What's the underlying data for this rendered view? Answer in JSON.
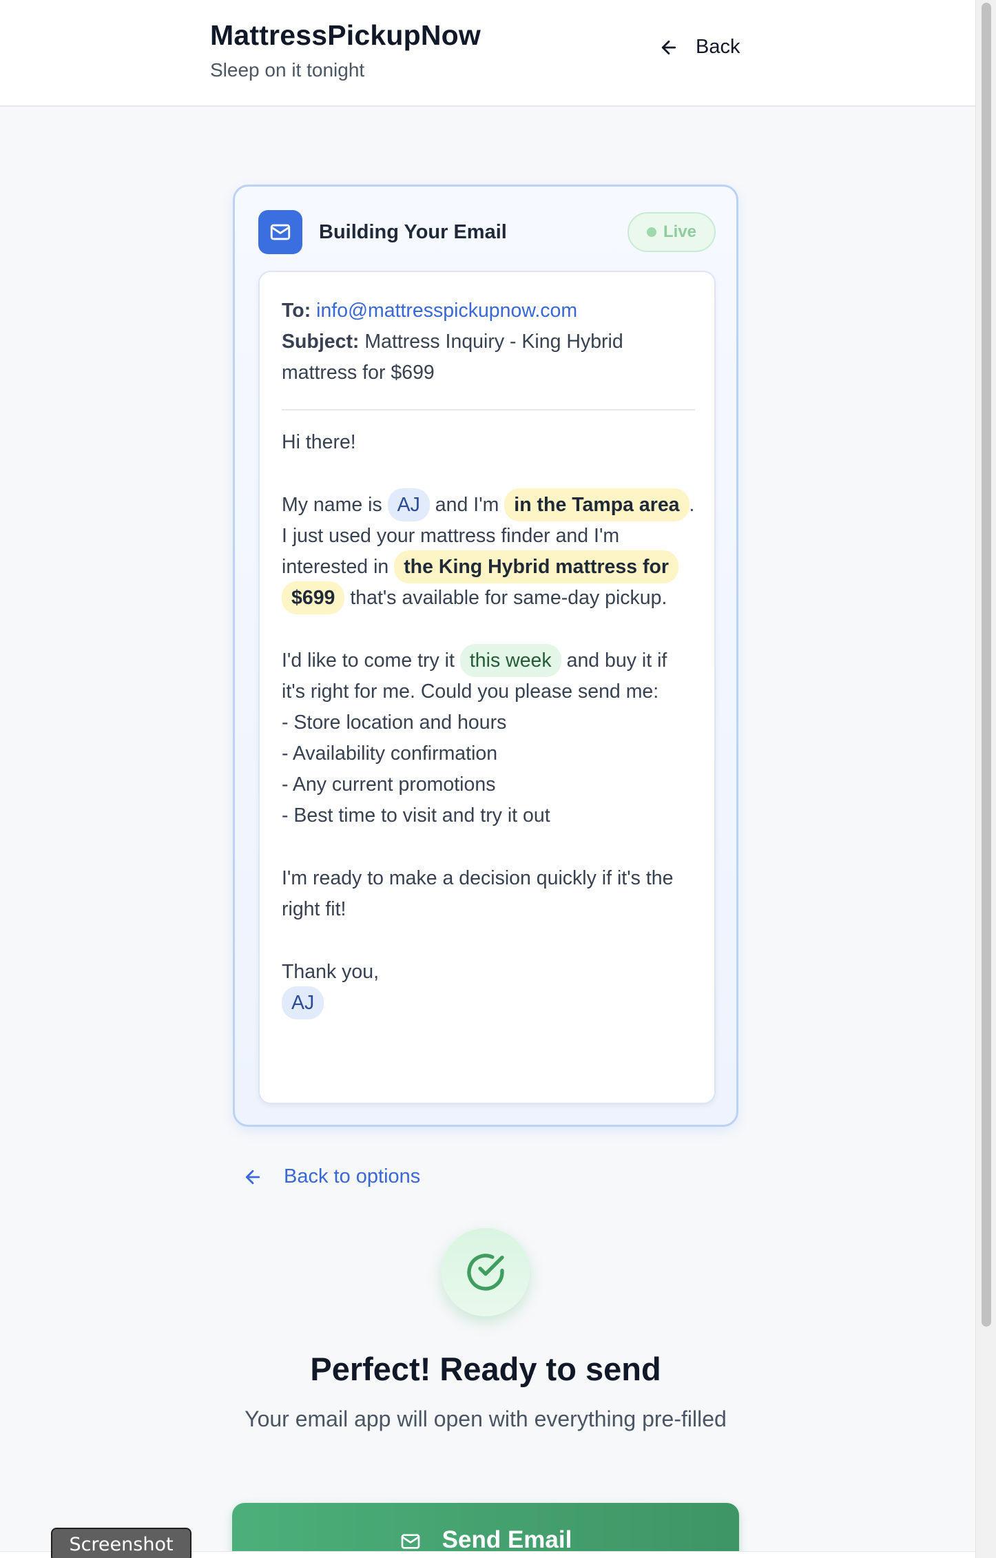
{
  "header": {
    "brand": "MattressPickupNow",
    "tagline": "Sleep on it tonight",
    "back_label": "Back"
  },
  "card": {
    "title": "Building Your Email",
    "status": "Live",
    "to_label": "To:",
    "to_value": "info@mattresspickupnow.com",
    "subject_label": "Subject:",
    "subject_value": "Mattress Inquiry - King Hybrid mattress for $699",
    "greeting": "Hi there!",
    "p1": {
      "a": "My name is ",
      "name": "AJ",
      "b": " and I'm ",
      "location": "in the Tampa area",
      "c": ". I just used your mattress finder and I'm interested in ",
      "product": "the King Hybrid mattress for $699",
      "d": " that's available for same-day pickup."
    },
    "p2": {
      "a": "I'd like to come try it ",
      "timeframe": "this week",
      "b": " and buy it if it's right for me. Could you please send me:"
    },
    "list": [
      "- Store location and hours",
      "- Availability confirmation",
      "- Any current promotions",
      "- Best time to visit and try it out"
    ],
    "p3": "I'm ready to make a decision quickly if it's the right fit!",
    "signoff": "Thank you,",
    "signature": "AJ"
  },
  "actions": {
    "back_to_options": "Back to options",
    "ready_title": "Perfect! Ready to send",
    "ready_subtitle": "Your email app will open with everything pre-filled",
    "send_label": "Send Email"
  },
  "overlay": {
    "screenshot_label": "Screenshot"
  },
  "colors": {
    "accent_blue": "#3b6fe0",
    "link_blue": "#3867d6",
    "success_green": "#4caf7a",
    "highlight_yellow": "#fdf5c6"
  }
}
